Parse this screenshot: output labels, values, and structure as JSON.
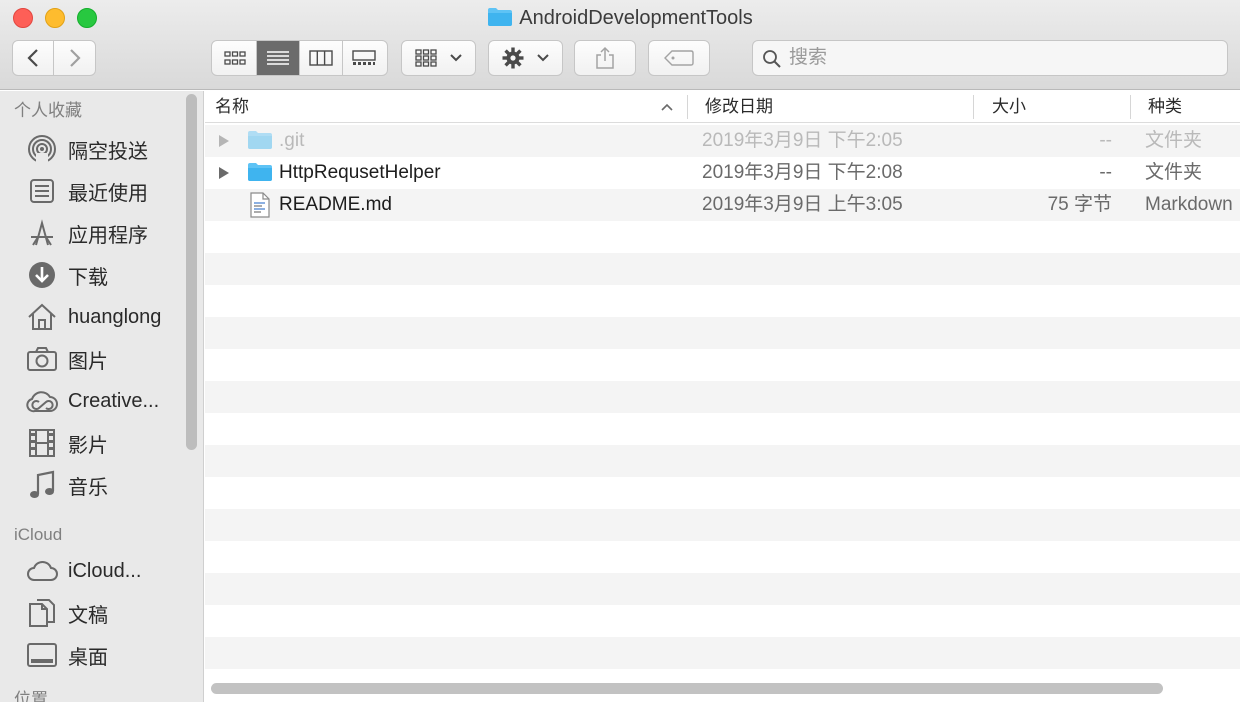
{
  "window": {
    "title": "AndroidDevelopmentTools",
    "buttons": {
      "close": "close",
      "minimize": "minimize",
      "zoom": "zoom"
    }
  },
  "toolbar": {
    "back_icon": "chevron-left-icon",
    "forward_icon": "chevron-right-icon",
    "view_modes": [
      "icon-view",
      "list-view",
      "column-view",
      "gallery-view"
    ],
    "active_view": "list-view",
    "group_icon": "group-by-icon",
    "action_icon": "gear-icon",
    "share_icon": "share-icon",
    "tag_icon": "tag-icon",
    "search_placeholder": "搜索"
  },
  "sidebar": {
    "sections": [
      {
        "heading": "个人收藏",
        "items": [
          {
            "label": "隔空投送",
            "icon": "airdrop-icon"
          },
          {
            "label": "最近使用",
            "icon": "recents-icon"
          },
          {
            "label": "应用程序",
            "icon": "applications-icon"
          },
          {
            "label": "下载",
            "icon": "downloads-icon"
          },
          {
            "label": "huanglong",
            "icon": "home-icon"
          },
          {
            "label": "图片",
            "icon": "camera-icon"
          },
          {
            "label": "Creative...",
            "icon": "creative-cloud-icon"
          },
          {
            "label": "影片",
            "icon": "film-icon"
          },
          {
            "label": "音乐",
            "icon": "music-icon"
          }
        ]
      },
      {
        "heading": "iCloud",
        "items": [
          {
            "label": "iCloud...",
            "icon": "icloud-icon"
          },
          {
            "label": "文稿",
            "icon": "documents-icon"
          },
          {
            "label": "桌面",
            "icon": "desktop-icon"
          }
        ]
      },
      {
        "heading": "位置",
        "items": []
      }
    ]
  },
  "columns": {
    "name": "名称",
    "date": "修改日期",
    "size": "大小",
    "kind": "种类"
  },
  "files": [
    {
      "name": ".git",
      "date": "2019年3月9日 下午2:05",
      "size": "--",
      "kind": "文件夹",
      "type": "folder",
      "hidden": true
    },
    {
      "name": "HttpRequsetHelper",
      "date": "2019年3月9日 下午2:08",
      "size": "--",
      "kind": "文件夹",
      "type": "folder",
      "hidden": false
    },
    {
      "name": "README.md",
      "date": "2019年3月9日 上午3:05",
      "size": "75 字节",
      "kind": "Markdown",
      "type": "document",
      "hidden": false
    }
  ],
  "colors": {
    "folder": "#3fb4ef",
    "active_segment": "#6b6b6b",
    "stripe": "#f4f4f4"
  }
}
